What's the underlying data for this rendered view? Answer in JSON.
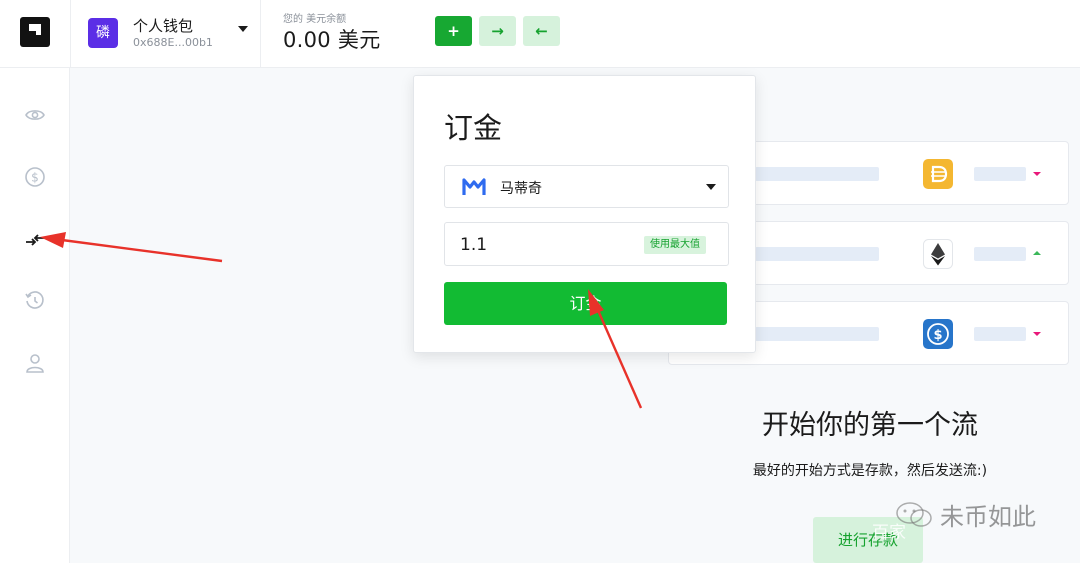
{
  "header": {
    "wallet": {
      "avatar_glyph": "磷",
      "name": "个人钱包",
      "address": "0x688E...00b1"
    },
    "balance_label": "您的 美元余额",
    "balance_value": "0.00 美元",
    "add_label": "+",
    "send_label": "→",
    "receive_label": "←"
  },
  "sidebar": {
    "items": [
      {
        "icon": "eye-icon"
      },
      {
        "icon": "dollar-circle-icon"
      },
      {
        "icon": "swap-arrows-icon"
      },
      {
        "icon": "history-icon"
      },
      {
        "icon": "user-icon"
      }
    ]
  },
  "deposit_panel": {
    "title": "订金",
    "token_name": "马蒂奇",
    "token_icon": "polygon-matic-icon",
    "amount": "1.1",
    "max_label": "使用最大值",
    "submit_label": "订金"
  },
  "asset_rows": [
    {
      "icon": "dai-icon",
      "trend": "down"
    },
    {
      "icon": "eth-icon",
      "trend": "up"
    },
    {
      "icon": "usdc-icon",
      "trend": "down"
    }
  ],
  "empty_state": {
    "title": "开始你的第一个流",
    "subtitle": "最好的开始方式是存款，然后发送流:)",
    "button_label": "进行存款"
  },
  "watermark": {
    "text": "未币如此",
    "sub": "百家"
  },
  "colors": {
    "primary_green": "#12bb33",
    "light_green": "#d6f2dc",
    "wallet_purple": "#5b2ee6",
    "arrow_red": "#e8322a"
  }
}
